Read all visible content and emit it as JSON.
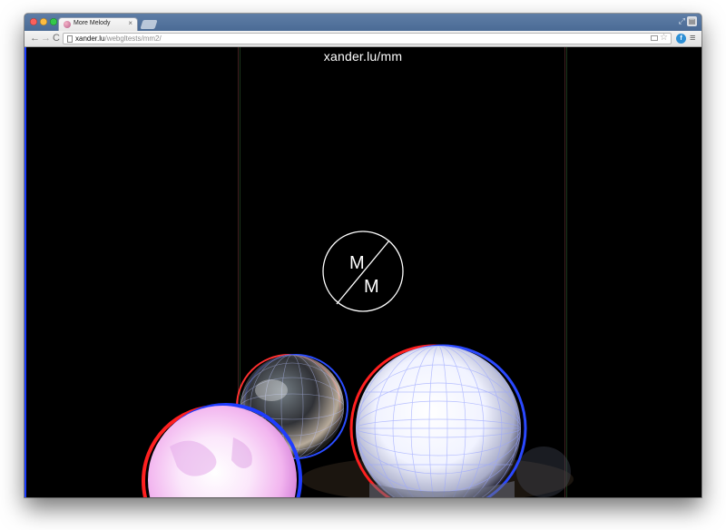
{
  "browser": {
    "tab_title": "More Melody",
    "tab_close_glyph": "×",
    "url_host": "xander.lu",
    "url_path": "/webgltests/mm2/",
    "back_glyph": "←",
    "forward_glyph": "→",
    "reload_glyph": "C",
    "menu_glyph": "≡",
    "star_glyph": "☆",
    "extension_glyph": "f",
    "resize_glyph": "⤢",
    "profile_glyph": "▤"
  },
  "page": {
    "heading": "xander.lu/mm",
    "logo": {
      "top_letter": "M",
      "bottom_letter": "M"
    }
  },
  "colors": {
    "page_background": "#000000",
    "text": "#ffffff",
    "tab_strip": "#5b7aa3"
  }
}
